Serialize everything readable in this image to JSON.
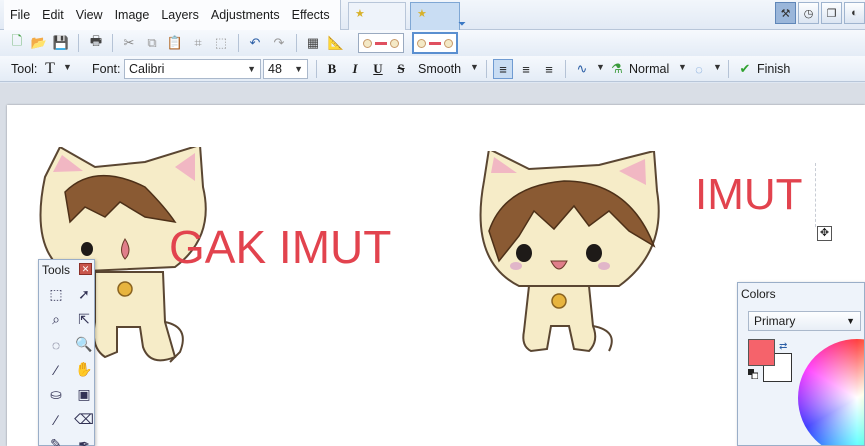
{
  "menu": [
    "File",
    "Edit",
    "View",
    "Image",
    "Layers",
    "Adjustments",
    "Effects"
  ],
  "tabs": [
    {
      "icon": "star-icon",
      "active": false
    },
    {
      "icon": "star-icon",
      "active": true
    }
  ],
  "toolbar": {
    "tool_label": "Tool:",
    "font_label": "Font:",
    "font_value": "Calibri",
    "size_value": "48",
    "bold": "B",
    "italic": "I",
    "underline": "U",
    "strikethrough": "S",
    "antialias": "Smooth",
    "blend_mode": "Normal",
    "finish": "Finish"
  },
  "canvas": {
    "text_left": "GAK IMUT",
    "text_right": "IMUT",
    "text_color": "#e2434e"
  },
  "tools_window": {
    "title": "Tools"
  },
  "colors_window": {
    "title": "Colors",
    "mode": "Primary",
    "primary_color": "#f5636b",
    "secondary_color": "#ffffff"
  }
}
